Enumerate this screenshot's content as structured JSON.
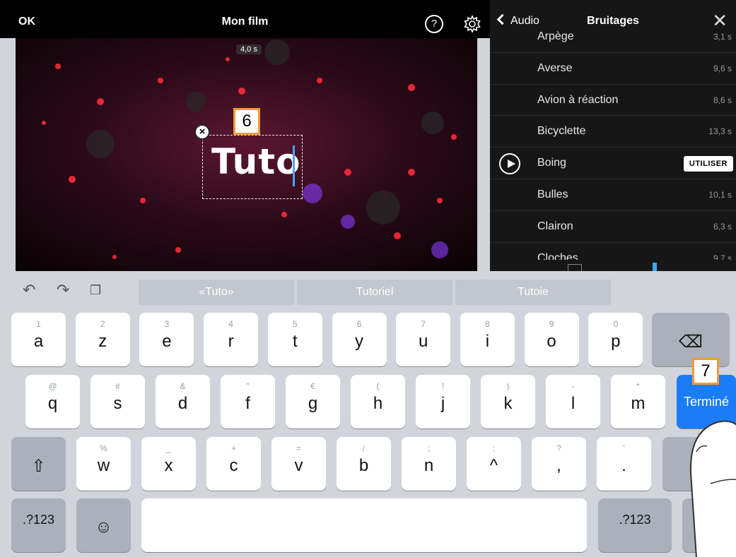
{
  "toolbar": {
    "ok": "OK",
    "title": "Mon film"
  },
  "preview": {
    "duration": "4,0 s",
    "text": "Tuto"
  },
  "callouts": {
    "first": "6",
    "second": "7"
  },
  "panel": {
    "back": "Audio",
    "title": "Bruitages",
    "items": [
      {
        "name": "Arpège",
        "duration": "3,1 s"
      },
      {
        "name": "Averse",
        "duration": "9,6 s"
      },
      {
        "name": "Avion à réaction",
        "duration": "8,6 s"
      },
      {
        "name": "Bicyclette",
        "duration": "13,3 s"
      },
      {
        "name": "Boing",
        "duration": "",
        "action": "UTILISER"
      },
      {
        "name": "Bulles",
        "duration": "10,1 s"
      },
      {
        "name": "Clairon",
        "duration": "6,3 s"
      },
      {
        "name": "Cloches",
        "duration": "9,7 s"
      }
    ]
  },
  "keyboard": {
    "suggestions": [
      "«Tuto»",
      "Tutoriel",
      "Tutoie"
    ],
    "row1": [
      {
        "k": "a",
        "s": "1"
      },
      {
        "k": "z",
        "s": "2"
      },
      {
        "k": "e",
        "s": "3"
      },
      {
        "k": "r",
        "s": "4"
      },
      {
        "k": "t",
        "s": "5"
      },
      {
        "k": "y",
        "s": "6"
      },
      {
        "k": "u",
        "s": "7"
      },
      {
        "k": "i",
        "s": "8"
      },
      {
        "k": "o",
        "s": "9"
      },
      {
        "k": "p",
        "s": "0"
      }
    ],
    "row2": [
      {
        "k": "q",
        "s": "@"
      },
      {
        "k": "s",
        "s": "#"
      },
      {
        "k": "d",
        "s": "&"
      },
      {
        "k": "f",
        "s": "\""
      },
      {
        "k": "g",
        "s": "€"
      },
      {
        "k": "h",
        "s": "("
      },
      {
        "k": "j",
        "s": "!"
      },
      {
        "k": "k",
        "s": ")"
      },
      {
        "k": "l",
        "s": "-"
      },
      {
        "k": "m",
        "s": "*"
      }
    ],
    "row3": [
      {
        "k": "w",
        "s": "%"
      },
      {
        "k": "x",
        "s": "_"
      },
      {
        "k": "c",
        "s": "+"
      },
      {
        "k": "v",
        "s": "="
      },
      {
        "k": "b",
        "s": "/"
      },
      {
        "k": "n",
        "s": ";"
      },
      {
        "k": "^",
        "s": ":"
      },
      {
        "k": ",",
        "s": "?"
      },
      {
        "k": ".",
        "s": "’"
      }
    ],
    "done": "Terminé",
    "numbers": ".?123",
    "numbers_right": ".?123"
  }
}
